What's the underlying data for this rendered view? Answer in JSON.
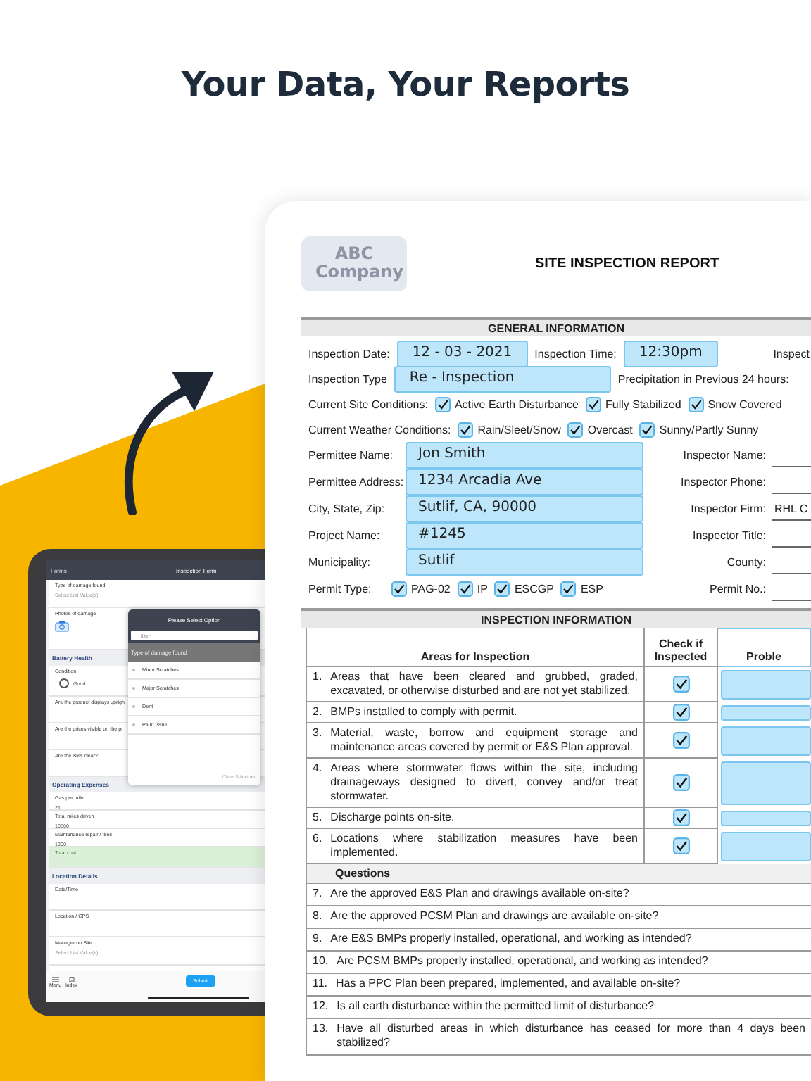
{
  "headline": "Your Data, Your Reports",
  "tablet": {
    "nav": {
      "back": "Forms",
      "title": "Inspection Form"
    },
    "form": [
      {
        "kind": "select",
        "label": "Type of damage found",
        "placeholder": "Select List Value(s)"
      },
      {
        "kind": "photo",
        "label": "Photos of damage"
      },
      {
        "kind": "section",
        "label": "Battery Health"
      },
      {
        "kind": "radio",
        "label": "Condition",
        "option": "Good",
        "selected": false
      },
      {
        "kind": "question",
        "label": "Are the product displays uprigh"
      },
      {
        "kind": "question",
        "label": "Are the prices visible on the pr"
      },
      {
        "kind": "question",
        "label": "Are the isles clear?"
      },
      {
        "kind": "section",
        "label": "Operating Expenses"
      },
      {
        "kind": "number",
        "label": "Gas per mile",
        "value": "21"
      },
      {
        "kind": "number",
        "label": "Total miles driven",
        "value": "10500"
      },
      {
        "kind": "number",
        "label": "Maintenance repair / tires",
        "value": "1200"
      },
      {
        "kind": "total",
        "label": "Total cost"
      },
      {
        "kind": "section",
        "label": "Location Details"
      },
      {
        "kind": "question",
        "label": "Date/Time"
      },
      {
        "kind": "question",
        "label": "Location / GPS"
      },
      {
        "kind": "select",
        "label": "Manager on Site",
        "placeholder": "Select List Value(s)"
      }
    ],
    "popover": {
      "title": "Please Select Option",
      "placeholder": "filter",
      "header": "Type of damage found",
      "options": [
        {
          "label": "Minor Scratches",
          "selected": false
        },
        {
          "label": "Major Scratches",
          "selected": false
        },
        {
          "label": "Dent",
          "selected": false
        },
        {
          "label": "Paint Issue",
          "selected": false
        }
      ],
      "clear": "Clear Selection"
    },
    "toolbar": {
      "menu": "Menu",
      "index": "Index",
      "submit": "Submit"
    }
  },
  "report": {
    "logo": "ABC Company",
    "title": "SITE INSPECTION REPORT",
    "general": {
      "heading": "GENERAL INFORMATION",
      "rows": [
        {
          "kind": "inline",
          "items": [
            {
              "kind": "label",
              "text": "Inspection Date:"
            },
            {
              "kind": "field",
              "text": "12 - 03 - 2021"
            },
            {
              "kind": "label",
              "text": "Inspection Time:"
            },
            {
              "kind": "field",
              "text": "12:30pm"
            },
            {
              "kind": "side",
              "text": "Inspect"
            }
          ]
        },
        {
          "kind": "inline",
          "items": [
            {
              "kind": "label",
              "text": "Inspection Type"
            },
            {
              "kind": "long_field",
              "text": "Re - Inspection"
            },
            {
              "kind": "label",
              "text": "Precipitation in Previous 24 hours:"
            }
          ]
        },
        {
          "kind": "inline",
          "items": [
            {
              "kind": "label",
              "text": "Current Site Conditions:"
            },
            {
              "kind": "check",
              "text": "Active Earth Disturbance",
              "checked": true
            },
            {
              "kind": "check",
              "text": "Fully Stabilized",
              "checked": true
            },
            {
              "kind": "check",
              "text": "Snow Covered",
              "checked": true
            }
          ]
        },
        {
          "kind": "inline",
          "items": [
            {
              "kind": "label",
              "text": "Current Weather Conditions:"
            },
            {
              "kind": "check",
              "text": "Rain/Sleet/Snow",
              "checked": true
            },
            {
              "kind": "check",
              "text": "Overcast",
              "checked": true
            },
            {
              "kind": "check",
              "text": "Sunny/Partly Sunny",
              "checked": true
            }
          ]
        },
        {
          "kind": "pair",
          "label": "Permittee Name:",
          "value": "Jon Smith",
          "side_label": "Inspector Name:"
        },
        {
          "kind": "pair",
          "label": "Permittee Address:",
          "value": "1234 Arcadia Ave",
          "side_label": "Inspector Phone:"
        },
        {
          "kind": "pair",
          "label": "City, State, Zip:",
          "value": "Sutlif, CA, 90000",
          "side_label": "Inspector Firm:",
          "side_value": "RHL C"
        },
        {
          "kind": "pair",
          "label": "Project Name:",
          "value": "#1245",
          "side_label": "Inspector Title:"
        },
        {
          "kind": "pair",
          "label": "Municipality:",
          "value": "Sutlif",
          "side_label": "County:"
        },
        {
          "kind": "pair_checks",
          "label": "Permit Type:",
          "checks": [
            {
              "text": "PAG-02",
              "checked": true
            },
            {
              "text": "IP",
              "checked": true
            },
            {
              "text": "ESCGP",
              "checked": true
            },
            {
              "text": "ESP",
              "checked": true
            }
          ],
          "side_label": "Permit No.:"
        }
      ]
    },
    "inspection": {
      "heading": "INSPECTION INFORMATION",
      "columns": [
        "Areas for Inspection",
        "Check if Inspected",
        "Proble"
      ],
      "areas": [
        {
          "number": "1.",
          "text": "Areas that have been cleared and grubbed, graded, excavated, or otherwise disturbed and are not yet stabilized.",
          "checked": true
        },
        {
          "number": "2.",
          "text": "BMPs installed to comply with permit.",
          "checked": true
        },
        {
          "number": "3.",
          "text": "Material, waste, borrow and equipment storage and maintenance areas covered by permit or E&S Plan approval.",
          "checked": true
        },
        {
          "number": "4.",
          "text": "Areas where stormwater flows within the site, including drainageways designed to divert, convey and/or treat stormwater.",
          "checked": true
        },
        {
          "number": "5.",
          "text": "Discharge points on-site.",
          "checked": true
        },
        {
          "number": "6.",
          "text": "Locations where stabilization measures have been implemented.",
          "checked": true
        }
      ],
      "questions_heading": "Questions",
      "questions": [
        {
          "number": "7.",
          "text": "Are the approved E&S Plan and drawings available on-site?"
        },
        {
          "number": "8.",
          "text": "Are the approved PCSM Plan and drawings are available on-site?"
        },
        {
          "number": "9.",
          "text": "Are E&S BMPs properly installed, operational, and working as intended?"
        },
        {
          "number": "10.",
          "text": "Are PCSM BMPs properly installed, operational, and working as intended?"
        },
        {
          "number": "11.",
          "text": "Has a PPC Plan been prepared, implemented, and available on-site?"
        },
        {
          "number": "12.",
          "text": "Is all earth disturbance within the permitted limit of disturbance?"
        },
        {
          "number": "13.",
          "text": "Have all disturbed areas in which disturbance has ceased for more than 4 days been stabilized?"
        }
      ]
    }
  }
}
